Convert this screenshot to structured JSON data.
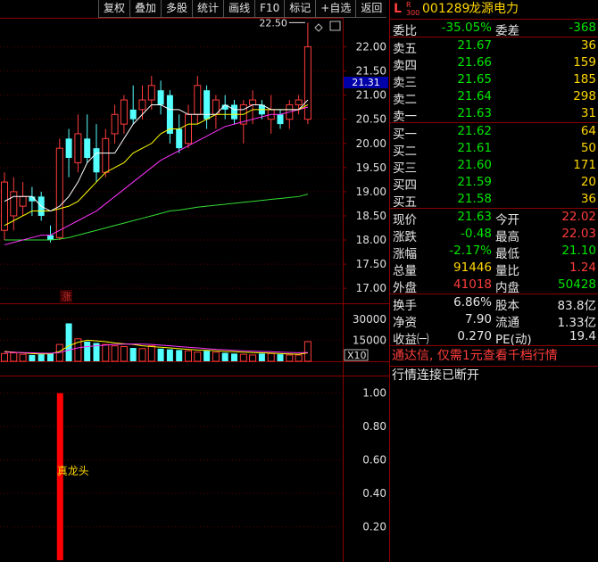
{
  "toolbar": [
    "复权",
    "叠加",
    "多股",
    "统计",
    "画线",
    "F10",
    "标记",
    "+自选",
    "返回"
  ],
  "header": {
    "flag_l": "L",
    "flag_r": "R\n300",
    "code": "001289",
    "name": "龙源电力"
  },
  "price_axis": [
    "22.00",
    "21.50",
    "21.00",
    "20.50",
    "20.00",
    "19.50",
    "19.00",
    "18.50",
    "18.00",
    "17.50",
    "17.00"
  ],
  "current_price_tag": "21.31",
  "high_annotation": "22.50",
  "zhang_marker": "涨",
  "vol_axis": [
    "30000",
    "15000"
  ],
  "vol_unit": "X10",
  "ind_axis": [
    "1.00",
    "0.80",
    "0.60",
    "0.40",
    "0.20"
  ],
  "ind_label": "真龙头",
  "weibi": {
    "label1": "委比",
    "val1": "-35.05%",
    "label2": "委差",
    "val2": "-368"
  },
  "asks": [
    {
      "label": "卖五",
      "price": "21.67",
      "vol": "36"
    },
    {
      "label": "卖四",
      "price": "21.66",
      "vol": "159"
    },
    {
      "label": "卖三",
      "price": "21.65",
      "vol": "185"
    },
    {
      "label": "卖二",
      "price": "21.64",
      "vol": "298"
    },
    {
      "label": "卖一",
      "price": "21.63",
      "vol": "31"
    }
  ],
  "bids": [
    {
      "label": "买一",
      "price": "21.62",
      "vol": "64"
    },
    {
      "label": "买二",
      "price": "21.61",
      "vol": "50"
    },
    {
      "label": "买三",
      "price": "21.60",
      "vol": "171"
    },
    {
      "label": "买四",
      "price": "21.59",
      "vol": "20"
    },
    {
      "label": "买五",
      "price": "21.58",
      "vol": "36"
    }
  ],
  "quote": [
    {
      "l1": "现价",
      "v1": "21.63",
      "c1": "g",
      "l2": "今开",
      "v2": "22.02",
      "c2": "r"
    },
    {
      "l1": "涨跌",
      "v1": "-0.48",
      "c1": "g",
      "l2": "最高",
      "v2": "22.03",
      "c2": "r"
    },
    {
      "l1": "涨幅",
      "v1": "-2.17%",
      "c1": "g",
      "l2": "最低",
      "v2": "21.10",
      "c2": "g"
    },
    {
      "l1": "总量",
      "v1": "91446",
      "c1": "y",
      "l2": "量比",
      "v2": "1.24",
      "c2": "r"
    },
    {
      "l1": "外盘",
      "v1": "41018",
      "c1": "r",
      "l2": "内盘",
      "v2": "50428",
      "c2": "g"
    }
  ],
  "stats": [
    {
      "l1": "换手",
      "v1": "6.86%",
      "l2": "股本",
      "v2": "83.8亿"
    },
    {
      "l1": "净资",
      "v1": "7.90",
      "l2": "流通",
      "v2": "1.33亿"
    },
    {
      "l1": "收益㈠",
      "v1": "0.270",
      "l2": "PE(动)",
      "v2": "19.4"
    }
  ],
  "promo": "通达信, 仅需1元查看千档行情",
  "status": "行情连接已断开",
  "colors": {
    "up": "#ff3c3c",
    "down": "#54ffff",
    "ma5": "#ffffff",
    "ma10": "#ffff00",
    "ma20": "#ff33ff",
    "ma60": "#33dd33",
    "border": "#8b0000"
  },
  "chart_data": {
    "type": "candlestick",
    "price_ylim": [
      16.8,
      22.6
    ],
    "candles": [
      {
        "o": 18.2,
        "h": 19.4,
        "l": 18.0,
        "c": 19.2
      },
      {
        "o": 18.5,
        "h": 19.3,
        "l": 18.2,
        "c": 19.0
      },
      {
        "o": 18.7,
        "h": 19.2,
        "l": 18.5,
        "c": 18.9
      },
      {
        "o": 18.9,
        "h": 19.1,
        "l": 18.5,
        "c": 18.8
      },
      {
        "o": 18.9,
        "h": 19.0,
        "l": 18.4,
        "c": 18.5
      },
      {
        "o": 18.1,
        "h": 18.3,
        "l": 17.95,
        "c": 18.0
      },
      {
        "o": 18.05,
        "h": 20.1,
        "l": 18.0,
        "c": 19.9
      },
      {
        "o": 20.1,
        "h": 20.3,
        "l": 19.3,
        "c": 19.7
      },
      {
        "o": 19.6,
        "h": 20.6,
        "l": 19.4,
        "c": 20.2
      },
      {
        "o": 20.1,
        "h": 20.6,
        "l": 19.6,
        "c": 19.7
      },
      {
        "o": 19.9,
        "h": 20.4,
        "l": 19.2,
        "c": 19.4
      },
      {
        "o": 19.4,
        "h": 20.3,
        "l": 19.3,
        "c": 20.1
      },
      {
        "o": 20.2,
        "h": 20.8,
        "l": 20.0,
        "c": 20.6
      },
      {
        "o": 20.4,
        "h": 21.0,
        "l": 20.2,
        "c": 20.9
      },
      {
        "o": 20.7,
        "h": 21.2,
        "l": 20.4,
        "c": 20.5
      },
      {
        "o": 20.7,
        "h": 21.2,
        "l": 20.5,
        "c": 20.9
      },
      {
        "o": 20.9,
        "h": 21.4,
        "l": 20.7,
        "c": 21.2
      },
      {
        "o": 21.1,
        "h": 21.3,
        "l": 20.6,
        "c": 20.8
      },
      {
        "o": 21.0,
        "h": 21.1,
        "l": 20.0,
        "c": 20.2
      },
      {
        "o": 20.3,
        "h": 20.6,
        "l": 19.8,
        "c": 19.9
      },
      {
        "o": 20.0,
        "h": 20.8,
        "l": 19.9,
        "c": 20.6
      },
      {
        "o": 20.6,
        "h": 21.4,
        "l": 20.4,
        "c": 21.2
      },
      {
        "o": 21.1,
        "h": 21.2,
        "l": 20.3,
        "c": 20.5
      },
      {
        "o": 20.6,
        "h": 21.0,
        "l": 20.3,
        "c": 20.9
      },
      {
        "o": 20.8,
        "h": 21.0,
        "l": 20.5,
        "c": 20.7
      },
      {
        "o": 20.8,
        "h": 20.9,
        "l": 20.4,
        "c": 20.5
      },
      {
        "o": 20.4,
        "h": 20.9,
        "l": 20.0,
        "c": 20.8
      },
      {
        "o": 20.8,
        "h": 21.1,
        "l": 20.4,
        "c": 20.9
      },
      {
        "o": 20.8,
        "h": 20.9,
        "l": 20.5,
        "c": 20.6
      },
      {
        "o": 20.5,
        "h": 21.0,
        "l": 20.2,
        "c": 20.7
      },
      {
        "o": 20.6,
        "h": 20.7,
        "l": 20.3,
        "c": 20.4
      },
      {
        "o": 20.5,
        "h": 20.9,
        "l": 20.3,
        "c": 20.8
      },
      {
        "o": 20.8,
        "h": 21.0,
        "l": 20.6,
        "c": 20.9
      },
      {
        "o": 20.5,
        "h": 22.5,
        "l": 20.4,
        "c": 22.0
      }
    ],
    "ma5": [
      18.8,
      18.9,
      18.9,
      18.9,
      18.7,
      18.6,
      18.7,
      18.9,
      19.2,
      19.6,
      19.8,
      19.8,
      19.8,
      20.1,
      20.4,
      20.6,
      20.8,
      20.8,
      20.7,
      20.7,
      20.6,
      20.6,
      20.6,
      20.6,
      20.8,
      20.7,
      20.7,
      20.8,
      20.8,
      20.7,
      20.7,
      20.7,
      20.7,
      20.9
    ],
    "ma10": [
      18.3,
      18.4,
      18.5,
      18.6,
      18.6,
      18.6,
      18.65,
      18.7,
      18.8,
      19.0,
      19.2,
      19.4,
      19.5,
      19.6,
      19.8,
      19.9,
      20.0,
      20.2,
      20.3,
      20.3,
      20.4,
      20.4,
      20.5,
      20.6,
      20.6,
      20.6,
      20.6,
      20.7,
      20.7,
      20.7,
      20.7,
      20.7,
      20.7,
      20.8
    ],
    "ma20": [
      17.9,
      17.95,
      18.0,
      18.05,
      18.1,
      18.1,
      18.2,
      18.3,
      18.4,
      18.5,
      18.6,
      18.75,
      18.9,
      19.05,
      19.2,
      19.35,
      19.5,
      19.65,
      19.75,
      19.85,
      19.95,
      20.05,
      20.15,
      20.25,
      20.35,
      20.4,
      20.45,
      20.5,
      20.55,
      20.6,
      20.6,
      20.65,
      20.7,
      20.75
    ],
    "ma60": [
      18.0,
      18.0,
      18.0,
      18.0,
      18.0,
      18.0,
      18.02,
      18.05,
      18.1,
      18.15,
      18.2,
      18.25,
      18.3,
      18.35,
      18.4,
      18.45,
      18.5,
      18.55,
      18.6,
      18.62,
      18.65,
      18.68,
      18.7,
      18.72,
      18.74,
      18.76,
      18.78,
      18.8,
      18.82,
      18.84,
      18.86,
      18.88,
      18.9,
      18.95
    ],
    "volume_ylim": [
      0,
      40000
    ],
    "volume": [
      5500,
      6000,
      5000,
      4500,
      5000,
      6000,
      12000,
      27000,
      16000,
      14000,
      13000,
      12000,
      11000,
      10500,
      9500,
      9000,
      11000,
      9000,
      8500,
      8000,
      7500,
      6500,
      7500,
      6500,
      6000,
      5500,
      5000,
      4500,
      5500,
      5500,
      5000,
      4500,
      4500,
      14000
    ],
    "vol_ma1": [
      7000,
      6500,
      6000,
      5500,
      5200,
      5300,
      7000,
      11000,
      13500,
      15000,
      14500,
      14000,
      13000,
      12500,
      12000,
      11000,
      10500,
      10000,
      9500,
      9000,
      8500,
      8000,
      7800,
      7500,
      7000,
      6800,
      6500,
      6200,
      6000,
      5800,
      5500,
      5200,
      5000,
      6000
    ],
    "vol_ma2": [
      6500,
      6400,
      6200,
      6000,
      5800,
      5700,
      6200,
      8000,
      9500,
      10500,
      11000,
      11500,
      12000,
      12200,
      12300,
      12200,
      12000,
      11500,
      11000,
      10500,
      10000,
      9500,
      9000,
      8500,
      8200,
      7800,
      7500,
      7200,
      7000,
      6800,
      6500,
      6300,
      6100,
      6300
    ],
    "indicator_ylim": [
      0,
      1.1
    ],
    "indicator_bar": {
      "index": 6,
      "value": 1.0
    }
  }
}
